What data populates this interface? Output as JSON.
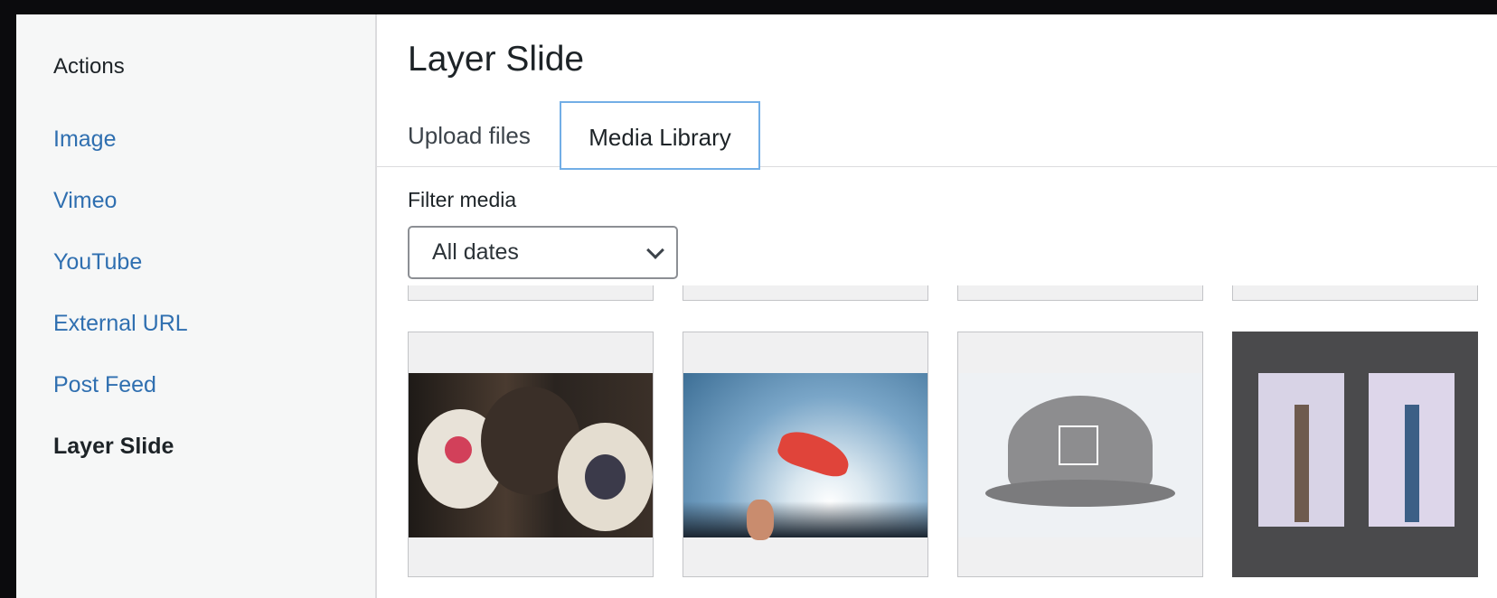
{
  "sidebar": {
    "heading": "Actions",
    "items": [
      {
        "label": "Image",
        "active": false
      },
      {
        "label": "Vimeo",
        "active": false
      },
      {
        "label": "YouTube",
        "active": false
      },
      {
        "label": "External URL",
        "active": false
      },
      {
        "label": "Post Feed",
        "active": false
      },
      {
        "label": "Layer Slide",
        "active": true
      }
    ]
  },
  "main": {
    "title": "Layer Slide",
    "tabs": [
      {
        "label": "Upload files",
        "active": false
      },
      {
        "label": "Media Library",
        "active": true
      }
    ],
    "filter_label": "Filter media",
    "date_filter": {
      "selected": "All dates"
    },
    "media": [
      {
        "subject": "woven bags"
      },
      {
        "subject": "flying sneaker"
      },
      {
        "subject": "grey cap"
      },
      {
        "subject": "dress shirts with ties"
      }
    ]
  },
  "colors": {
    "link": "#2f6fb0",
    "tab_focus": "#72aee6",
    "sidebar_bg": "#f6f7f7"
  }
}
